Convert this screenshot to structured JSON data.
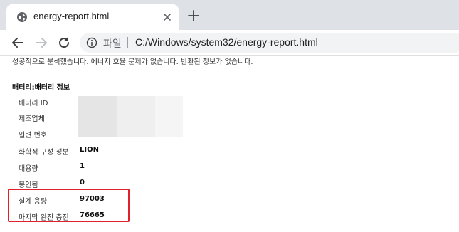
{
  "browser": {
    "tab": {
      "title": "energy-report.html",
      "favicon": "globe-icon"
    },
    "new_tab": "plus-icon",
    "address": {
      "label": "파일",
      "url": "C:/Windows/system32/energy-report.html"
    }
  },
  "report": {
    "status_line": "성공적으로 분석했습니다. 에너지 효율 문제가 없습니다. 반환된 정보가 없습니다.",
    "section_title": "배터리:배터리 정보",
    "rows": [
      {
        "label": "배터리 ID",
        "value": ""
      },
      {
        "label": "제조업체",
        "value": ""
      },
      {
        "label": "일련 번호",
        "value": ""
      },
      {
        "label": "화학적 구성 성분",
        "value": "LION"
      },
      {
        "label": "대용량",
        "value": "1"
      },
      {
        "label": "봉인됨",
        "value": "0"
      },
      {
        "label": "설계 용량",
        "value": "97003"
      },
      {
        "label": "마지막 완전 충전",
        "value": "76665"
      }
    ],
    "highlight_color": "#e0202a"
  }
}
